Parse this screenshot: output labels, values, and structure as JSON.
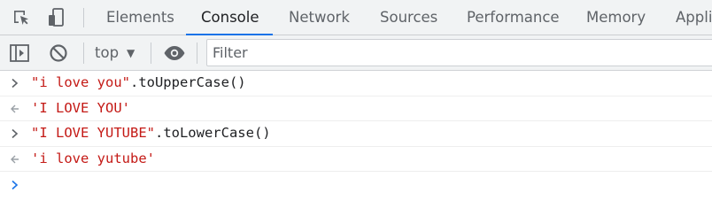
{
  "devtools": {
    "tabs": [
      {
        "label": "Elements"
      },
      {
        "label": "Console"
      },
      {
        "label": "Network"
      },
      {
        "label": "Sources"
      },
      {
        "label": "Performance"
      },
      {
        "label": "Memory"
      },
      {
        "label": "Appli"
      }
    ],
    "active_tab": "Console",
    "accent_color": "#1a73e8"
  },
  "toolbar": {
    "context": "top",
    "filter_placeholder": "Filter"
  },
  "console": {
    "entries": [
      {
        "kind": "input",
        "string": "\"i love you\"",
        "rest": ".toUpperCase()"
      },
      {
        "kind": "result",
        "value": "'I LOVE YOU'"
      },
      {
        "kind": "input",
        "string": "\"I LOVE YUTUBE\"",
        "rest": ".toLowerCase()"
      },
      {
        "kind": "result",
        "value": "'i love yutube'"
      }
    ],
    "string_color": "#c41a16"
  }
}
